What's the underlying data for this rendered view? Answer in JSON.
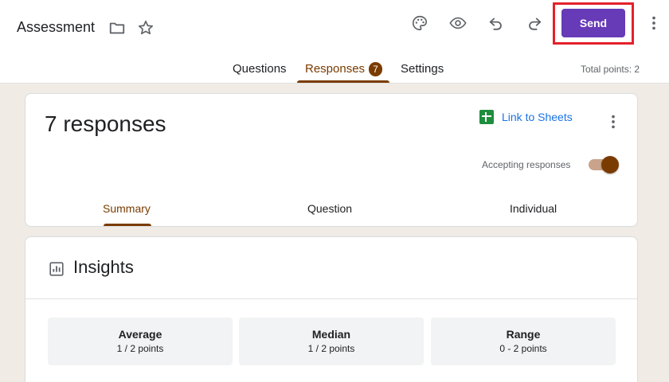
{
  "header": {
    "doc_title": "Assessment",
    "send_label": "Send",
    "icons": [
      "folder-icon",
      "star-icon",
      "palette-icon",
      "eye-icon",
      "undo-icon",
      "redo-icon",
      "more-vert-icon"
    ]
  },
  "tabs": [
    {
      "label": "Questions"
    },
    {
      "label": "Responses",
      "count": "7"
    },
    {
      "label": "Settings"
    }
  ],
  "total_points": "Total points: 2",
  "responses_card": {
    "title": "7 responses",
    "link_to_sheets": "Link to Sheets",
    "accepting_label": "Accepting responses",
    "accepting_on": true,
    "subtabs": [
      {
        "label": "Summary"
      },
      {
        "label": "Question"
      },
      {
        "label": "Individual"
      }
    ]
  },
  "insights": {
    "title": "Insights",
    "stats": [
      {
        "label": "Average",
        "value": "1 / 2 points"
      },
      {
        "label": "Median",
        "value": "1 / 2 points"
      },
      {
        "label": "Range",
        "value": "0 - 2 points"
      }
    ]
  },
  "colors": {
    "accent": "#7a3b00",
    "send_button": "#673ab7",
    "highlight_outline": "#e3212a",
    "background": "#f0ebe5"
  }
}
